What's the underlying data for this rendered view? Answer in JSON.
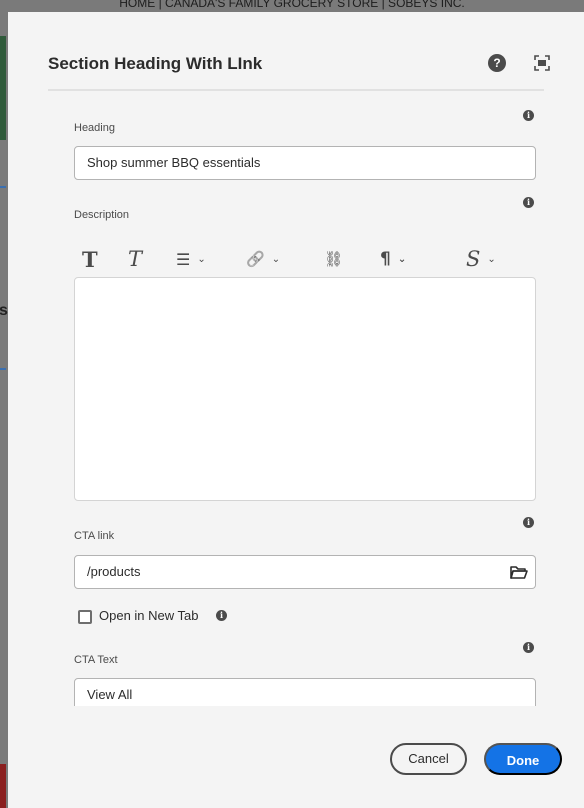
{
  "background": {
    "topbar_text": "HOME | CANADA'S FAMILY GROCERY STORE | SOBEYS INC.",
    "side_letter": "s"
  },
  "dialog": {
    "title": "Section Heading With LInk",
    "help_icon": "?",
    "fields": {
      "heading": {
        "label": "Heading",
        "value": "Shop summer BBQ essentials"
      },
      "description": {
        "label": "Description",
        "value": ""
      },
      "cta_link": {
        "label": "CTA link",
        "value": "/products"
      },
      "open_new_tab": {
        "label": "Open in New Tab",
        "checked": false
      },
      "cta_text": {
        "label": "CTA Text",
        "value": "View All"
      }
    },
    "info_icon": "i",
    "toolbar": {
      "bold": "T",
      "italic": "T",
      "list": "☰",
      "link": "🔗",
      "unlink": "⛓",
      "paragraph": "¶",
      "styles": "S",
      "chevron": "⌄"
    },
    "buttons": {
      "cancel": "Cancel",
      "done": "Done"
    }
  },
  "colors": {
    "accent": "#1473e6",
    "dialog_bg": "#f4f4f4",
    "text": "#2c2c2c"
  }
}
